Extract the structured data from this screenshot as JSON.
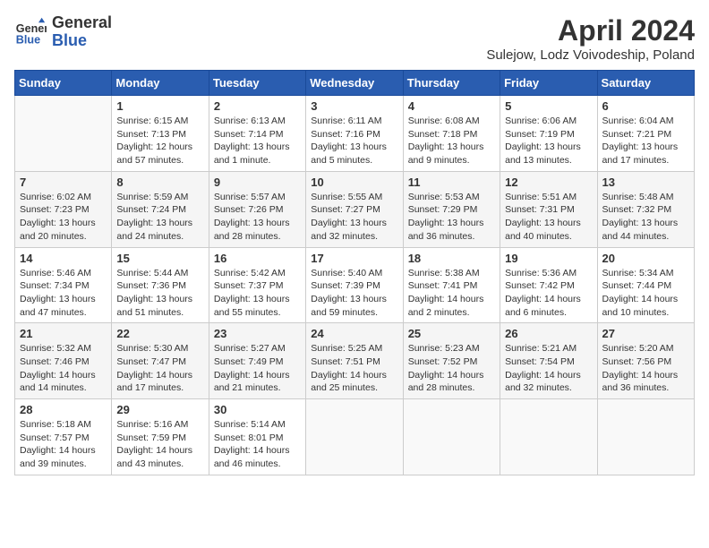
{
  "logo": {
    "general": "General",
    "blue": "Blue"
  },
  "header": {
    "title": "April 2024",
    "location": "Sulejow, Lodz Voivodeship, Poland"
  },
  "days_of_week": [
    "Sunday",
    "Monday",
    "Tuesday",
    "Wednesday",
    "Thursday",
    "Friday",
    "Saturday"
  ],
  "weeks": [
    [
      {
        "day": "",
        "info": ""
      },
      {
        "day": "1",
        "info": "Sunrise: 6:15 AM\nSunset: 7:13 PM\nDaylight: 12 hours\nand 57 minutes."
      },
      {
        "day": "2",
        "info": "Sunrise: 6:13 AM\nSunset: 7:14 PM\nDaylight: 13 hours\nand 1 minute."
      },
      {
        "day": "3",
        "info": "Sunrise: 6:11 AM\nSunset: 7:16 PM\nDaylight: 13 hours\nand 5 minutes."
      },
      {
        "day": "4",
        "info": "Sunrise: 6:08 AM\nSunset: 7:18 PM\nDaylight: 13 hours\nand 9 minutes."
      },
      {
        "day": "5",
        "info": "Sunrise: 6:06 AM\nSunset: 7:19 PM\nDaylight: 13 hours\nand 13 minutes."
      },
      {
        "day": "6",
        "info": "Sunrise: 6:04 AM\nSunset: 7:21 PM\nDaylight: 13 hours\nand 17 minutes."
      }
    ],
    [
      {
        "day": "7",
        "info": "Sunrise: 6:02 AM\nSunset: 7:23 PM\nDaylight: 13 hours\nand 20 minutes."
      },
      {
        "day": "8",
        "info": "Sunrise: 5:59 AM\nSunset: 7:24 PM\nDaylight: 13 hours\nand 24 minutes."
      },
      {
        "day": "9",
        "info": "Sunrise: 5:57 AM\nSunset: 7:26 PM\nDaylight: 13 hours\nand 28 minutes."
      },
      {
        "day": "10",
        "info": "Sunrise: 5:55 AM\nSunset: 7:27 PM\nDaylight: 13 hours\nand 32 minutes."
      },
      {
        "day": "11",
        "info": "Sunrise: 5:53 AM\nSunset: 7:29 PM\nDaylight: 13 hours\nand 36 minutes."
      },
      {
        "day": "12",
        "info": "Sunrise: 5:51 AM\nSunset: 7:31 PM\nDaylight: 13 hours\nand 40 minutes."
      },
      {
        "day": "13",
        "info": "Sunrise: 5:48 AM\nSunset: 7:32 PM\nDaylight: 13 hours\nand 44 minutes."
      }
    ],
    [
      {
        "day": "14",
        "info": "Sunrise: 5:46 AM\nSunset: 7:34 PM\nDaylight: 13 hours\nand 47 minutes."
      },
      {
        "day": "15",
        "info": "Sunrise: 5:44 AM\nSunset: 7:36 PM\nDaylight: 13 hours\nand 51 minutes."
      },
      {
        "day": "16",
        "info": "Sunrise: 5:42 AM\nSunset: 7:37 PM\nDaylight: 13 hours\nand 55 minutes."
      },
      {
        "day": "17",
        "info": "Sunrise: 5:40 AM\nSunset: 7:39 PM\nDaylight: 13 hours\nand 59 minutes."
      },
      {
        "day": "18",
        "info": "Sunrise: 5:38 AM\nSunset: 7:41 PM\nDaylight: 14 hours\nand 2 minutes."
      },
      {
        "day": "19",
        "info": "Sunrise: 5:36 AM\nSunset: 7:42 PM\nDaylight: 14 hours\nand 6 minutes."
      },
      {
        "day": "20",
        "info": "Sunrise: 5:34 AM\nSunset: 7:44 PM\nDaylight: 14 hours\nand 10 minutes."
      }
    ],
    [
      {
        "day": "21",
        "info": "Sunrise: 5:32 AM\nSunset: 7:46 PM\nDaylight: 14 hours\nand 14 minutes."
      },
      {
        "day": "22",
        "info": "Sunrise: 5:30 AM\nSunset: 7:47 PM\nDaylight: 14 hours\nand 17 minutes."
      },
      {
        "day": "23",
        "info": "Sunrise: 5:27 AM\nSunset: 7:49 PM\nDaylight: 14 hours\nand 21 minutes."
      },
      {
        "day": "24",
        "info": "Sunrise: 5:25 AM\nSunset: 7:51 PM\nDaylight: 14 hours\nand 25 minutes."
      },
      {
        "day": "25",
        "info": "Sunrise: 5:23 AM\nSunset: 7:52 PM\nDaylight: 14 hours\nand 28 minutes."
      },
      {
        "day": "26",
        "info": "Sunrise: 5:21 AM\nSunset: 7:54 PM\nDaylight: 14 hours\nand 32 minutes."
      },
      {
        "day": "27",
        "info": "Sunrise: 5:20 AM\nSunset: 7:56 PM\nDaylight: 14 hours\nand 36 minutes."
      }
    ],
    [
      {
        "day": "28",
        "info": "Sunrise: 5:18 AM\nSunset: 7:57 PM\nDaylight: 14 hours\nand 39 minutes."
      },
      {
        "day": "29",
        "info": "Sunrise: 5:16 AM\nSunset: 7:59 PM\nDaylight: 14 hours\nand 43 minutes."
      },
      {
        "day": "30",
        "info": "Sunrise: 5:14 AM\nSunset: 8:01 PM\nDaylight: 14 hours\nand 46 minutes."
      },
      {
        "day": "",
        "info": ""
      },
      {
        "day": "",
        "info": ""
      },
      {
        "day": "",
        "info": ""
      },
      {
        "day": "",
        "info": ""
      }
    ]
  ]
}
